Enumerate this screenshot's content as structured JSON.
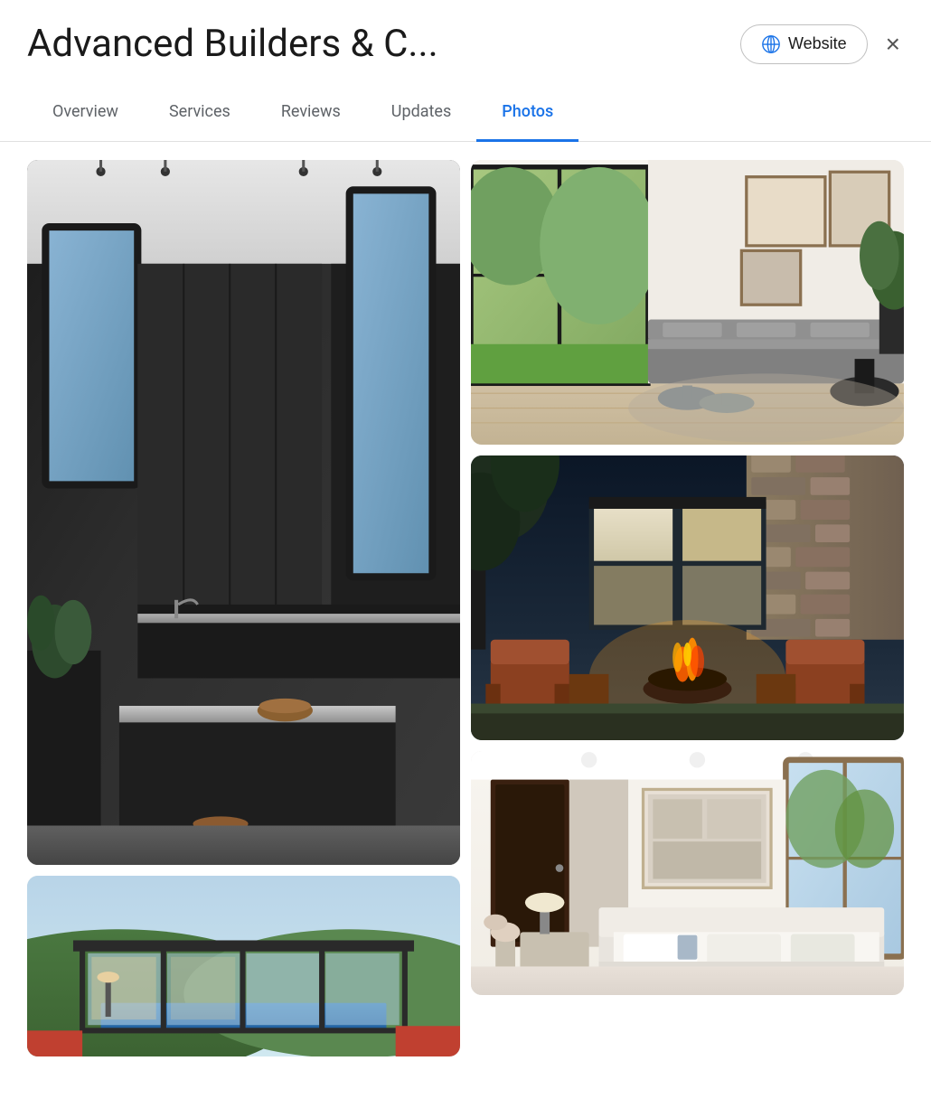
{
  "header": {
    "title": "Advanced Builders & C...",
    "website_button": "Website",
    "close_label": "×"
  },
  "tabs": [
    {
      "id": "overview",
      "label": "Overview",
      "active": false
    },
    {
      "id": "services",
      "label": "Services",
      "active": false
    },
    {
      "id": "reviews",
      "label": "Reviews",
      "active": false
    },
    {
      "id": "updates",
      "label": "Updates",
      "active": false
    },
    {
      "id": "photos",
      "label": "Photos",
      "active": true
    }
  ],
  "photos": {
    "items": [
      {
        "id": "kitchen",
        "alt": "Modern kitchen with dark walls and island",
        "col": "left",
        "size": "large"
      },
      {
        "id": "glass-lower",
        "alt": "Glass wall house exterior with pool view",
        "col": "left",
        "size": "small"
      },
      {
        "id": "living-room",
        "alt": "Bright living room with large windows",
        "col": "right",
        "size": "medium-top"
      },
      {
        "id": "outdoor-firepit",
        "alt": "Outdoor patio with firepit at night",
        "col": "right",
        "size": "medium-mid"
      },
      {
        "id": "bedroom",
        "alt": "White bedroom with natural light",
        "col": "right",
        "size": "medium-bot"
      }
    ]
  },
  "colors": {
    "active_tab": "#1a73e8",
    "tab_inactive": "#5f6368",
    "divider": "#e0e0e0"
  }
}
